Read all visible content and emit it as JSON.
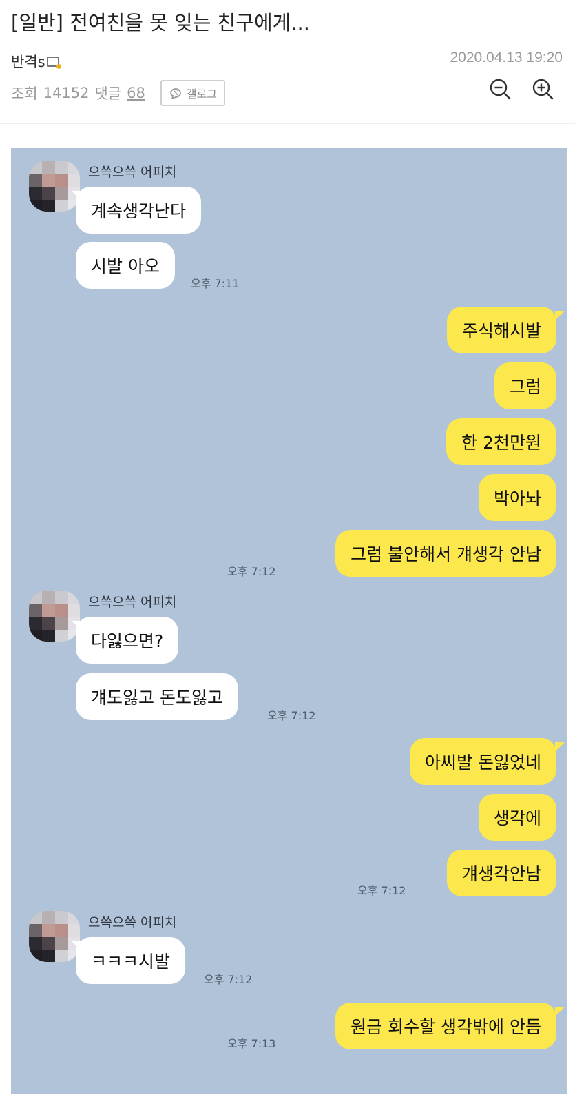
{
  "post": {
    "title": "[일반] 전여친을 못 잊는 친구에게...",
    "author": "반격s",
    "date": "2020.04.13 19:20",
    "views_label": "조회",
    "views": "14152",
    "comments_label": "댓글",
    "comments": "68",
    "gallog_label": "갤로그"
  },
  "chat": {
    "sender_name": "으쓱으쓱 어피치",
    "colors": {
      "background": "#b1c3d8",
      "incoming": "#ffffff",
      "outgoing": "#fce74c"
    },
    "messages": [
      {
        "text": "계속생각난다",
        "side": "in"
      },
      {
        "text": "시발 아오",
        "side": "in",
        "time": "오후 7:11"
      },
      {
        "text": "주식해시발",
        "side": "out"
      },
      {
        "text": "그럼",
        "side": "out"
      },
      {
        "text": "한 2천만원",
        "side": "out"
      },
      {
        "text": "박아놔",
        "side": "out"
      },
      {
        "text": "그럼 불안해서 걔생각 안남",
        "side": "out",
        "time": "오후 7:12"
      },
      {
        "text": "다잃으면?",
        "side": "in"
      },
      {
        "text": "걔도잃고 돈도잃고",
        "side": "in",
        "time": "오후 7:12"
      },
      {
        "text": "아씨발 돈잃었네",
        "side": "out"
      },
      {
        "text": "생각에",
        "side": "out"
      },
      {
        "text": "걔생각안남",
        "side": "out",
        "time": "오후 7:12"
      },
      {
        "text": "ㅋㅋㅋ시발",
        "side": "in",
        "time": "오후 7:12"
      },
      {
        "text": "원금 회수할 생각밖에 안듬",
        "side": "out",
        "time": "오후 7:13"
      }
    ]
  }
}
